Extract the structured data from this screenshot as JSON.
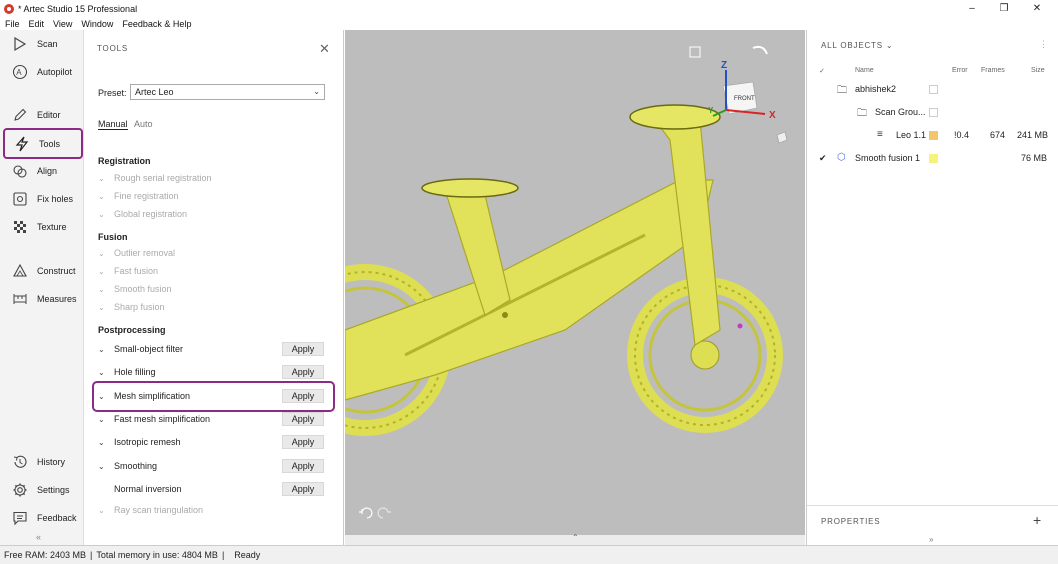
{
  "window": {
    "title": "* Artec Studio 15 Professional",
    "controls": {
      "minimize": "–",
      "maximize": "❐",
      "close": "✕"
    }
  },
  "menu": [
    "File",
    "Edit",
    "View",
    "Window",
    "Feedback & Help"
  ],
  "nav": {
    "items": [
      {
        "label": "Scan",
        "icon": "play-icon"
      },
      {
        "label": "Autopilot",
        "icon": "autopilot-icon"
      },
      {
        "label": "Editor",
        "icon": "pencil-icon"
      },
      {
        "label": "Tools",
        "icon": "lightning-icon"
      },
      {
        "label": "Align",
        "icon": "align-icon"
      },
      {
        "label": "Fix holes",
        "icon": "fix-holes-icon"
      },
      {
        "label": "Texture",
        "icon": "texture-icon"
      },
      {
        "label": "Construct",
        "icon": "construct-icon"
      },
      {
        "label": "Measures",
        "icon": "measures-icon"
      },
      {
        "label": "History",
        "icon": "history-icon"
      },
      {
        "label": "Settings",
        "icon": "gear-icon"
      },
      {
        "label": "Feedback",
        "icon": "feedback-icon"
      }
    ],
    "active": "Tools",
    "collapse": "«"
  },
  "tools": {
    "title": "TOOLS",
    "close": "✕",
    "preset_label": "Preset:",
    "preset_value": "Artec Leo",
    "tab_manual": "Manual",
    "tab_auto": "Auto",
    "sections": {
      "registration": "Registration",
      "fusion": "Fusion",
      "postprocessing": "Postprocessing"
    },
    "registration_items": [
      "Rough serial registration",
      "Fine registration",
      "Global registration"
    ],
    "fusion_items": [
      "Outlier removal",
      "Fast fusion",
      "Smooth fusion",
      "Sharp fusion"
    ],
    "post_items": [
      "Small-object filter",
      "Hole filling",
      "Mesh simplification",
      "Fast mesh simplification",
      "Isotropic remesh",
      "Smoothing",
      "Normal inversion",
      "Ray scan triangulation"
    ],
    "apply_label": "Apply"
  },
  "viewport": {
    "gizmo": {
      "z": "Z",
      "x": "X",
      "y": "Y",
      "face": "FRONT"
    },
    "colors": {
      "background": "#bdbdbd",
      "model": "#e2e25a",
      "model_shadow": "#b5b52c"
    }
  },
  "objects": {
    "title": "ALL OBJECTS",
    "more": "⋮",
    "columns": {
      "check": "✓",
      "name": "Name",
      "error": "Error",
      "frames": "Frames",
      "size": "Size"
    },
    "rows": [
      {
        "name": "abhishek2",
        "error": "",
        "frames": "",
        "size": ""
      },
      {
        "name": "Scan Grou...",
        "error": "",
        "frames": "",
        "size": ""
      },
      {
        "name": "Leo 1.1",
        "error": "!0.4",
        "frames": "674",
        "size": "241 MB",
        "color": "#f5c56b"
      },
      {
        "name": "Smooth fusion 1",
        "error": "",
        "frames": "",
        "size": "76 MB",
        "color": "#f7f27a",
        "checked": "✔"
      }
    ],
    "properties": "PROPERTIES",
    "properties_add": "+",
    "expand": "»"
  },
  "status": {
    "free_ram": "Free RAM: 2403 MB",
    "sep1": "|",
    "total_memory": "Total memory in use: 4804 MB",
    "sep2": "|",
    "state": "Ready"
  }
}
